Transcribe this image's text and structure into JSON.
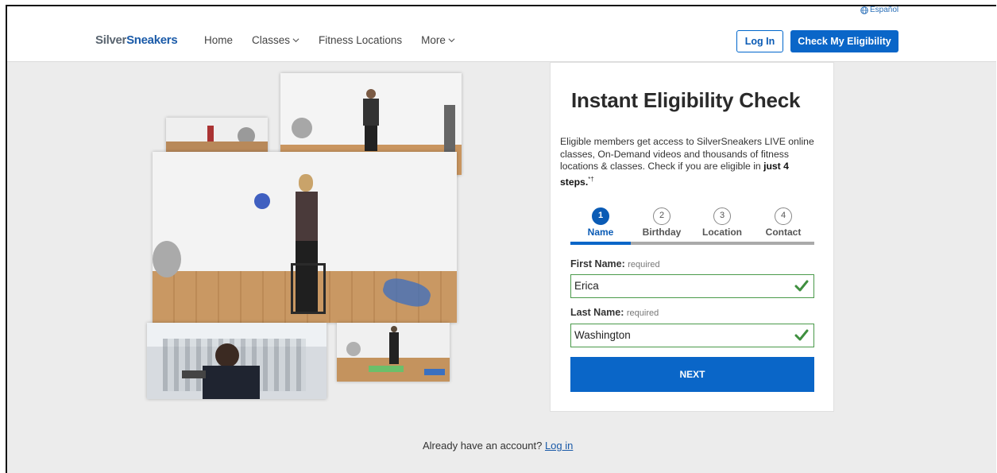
{
  "header": {
    "language": "Español",
    "logo": {
      "part1": "Silver",
      "part2": "Sneakers"
    },
    "nav": [
      {
        "label": "Home",
        "dropdown": false
      },
      {
        "label": "Classes",
        "dropdown": true
      },
      {
        "label": "Fitness Locations",
        "dropdown": false
      },
      {
        "label": "More",
        "dropdown": true
      }
    ],
    "login_label": "Log In",
    "eligibility_label": "Check My Eligibility"
  },
  "card": {
    "title": "Instant Eligibility Check",
    "description": "Eligible members get access to SilverSneakers LIVE online classes, On-Demand videos and thousands of fitness locations & classes. Check if you are eligible in",
    "description_bold": "just 4 steps.",
    "description_sup": "*†",
    "steps": [
      {
        "number": "1",
        "label": "Name",
        "active": true
      },
      {
        "number": "2",
        "label": "Birthday",
        "active": false
      },
      {
        "number": "3",
        "label": "Location",
        "active": false
      },
      {
        "number": "4",
        "label": "Contact",
        "active": false
      }
    ],
    "first_name": {
      "label": "First Name:",
      "required": "required",
      "value": "Erica"
    },
    "last_name": {
      "label": "Last Name:",
      "required": "required",
      "value": "Washington"
    },
    "next_label": "NEXT"
  },
  "footer": {
    "account_text": "Already have an account?",
    "login_link": "Log in"
  },
  "colors": {
    "brand_blue": "#0a66c8",
    "valid_green": "#3f8f3f",
    "background": "#ececec"
  }
}
